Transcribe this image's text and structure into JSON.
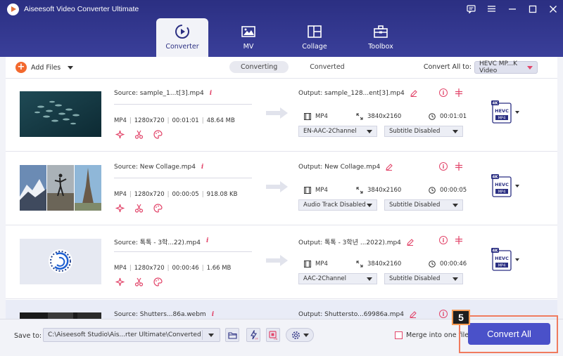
{
  "app": {
    "title": "Aiseesoft Video Converter Ultimate"
  },
  "nav": {
    "tabs": [
      {
        "label": "Converter",
        "icon": "converter-icon",
        "active": true
      },
      {
        "label": "MV",
        "icon": "image-icon",
        "active": false
      },
      {
        "label": "Collage",
        "icon": "collage-icon",
        "active": false
      },
      {
        "label": "Toolbox",
        "icon": "toolbox-icon",
        "active": false
      }
    ]
  },
  "toolbar": {
    "add_files": "Add Files",
    "tab_converting": "Converting",
    "tab_converted": "Converted",
    "convert_all_to": "Convert All to:",
    "format": "HEVC MP...K Video"
  },
  "items": [
    {
      "source": "Source: sample_1...t[3].mp4",
      "src_format": "MP4",
      "src_res": "1280x720",
      "src_dur": "00:01:01",
      "src_size": "48.64 MB",
      "output": "Output: sample_128...ent[3].mp4",
      "out_format": "MP4",
      "out_res": "3840x2160",
      "out_dur": "00:01:01",
      "audio": "EN-AAC-2Channel",
      "subtitle": "Subtitle Disabled",
      "badge_top": "4K",
      "badge_mid": "HEVC",
      "badge_bot": "MP4"
    },
    {
      "source": "Source: New Collage.mp4",
      "src_format": "MP4",
      "src_res": "1280x720",
      "src_dur": "00:00:05",
      "src_size": "918.08 KB",
      "output": "Output: New Collage.mp4",
      "out_format": "MP4",
      "out_res": "3840x2160",
      "out_dur": "00:00:05",
      "audio": "Audio Track Disabled",
      "subtitle": "Subtitle Disabled",
      "badge_top": "4K",
      "badge_mid": "HEVC",
      "badge_bot": "MP4"
    },
    {
      "source": "Source: 톡톡 - 3학...22).mp4",
      "src_format": "MP4",
      "src_res": "1280x720",
      "src_dur": "00:00:46",
      "src_size": "1.66 MB",
      "output": "Output: 톡톡 - 3학년 ...2022).mp4",
      "out_format": "MP4",
      "out_res": "3840x2160",
      "out_dur": "00:00:46",
      "audio": "AAC-2Channel",
      "subtitle": "Subtitle Disabled",
      "badge_top": "4K",
      "badge_mid": "HEVC",
      "badge_bot": "MP4"
    },
    {
      "source": "Source: Shutters...86a.webm",
      "output": "Output: Shuttersto...69986a.mp4"
    }
  ],
  "bottom": {
    "save_to": "Save to:",
    "path": "C:\\Aiseesoft Studio\\Ais...rter Ultimate\\Converted",
    "merge": "Merge into one file",
    "convert_all": "Convert All",
    "step": "5"
  },
  "colors": {
    "header": "#2b2f82",
    "accent": "#e2456a",
    "button": "#4a51c9",
    "add": "#f3692e"
  }
}
